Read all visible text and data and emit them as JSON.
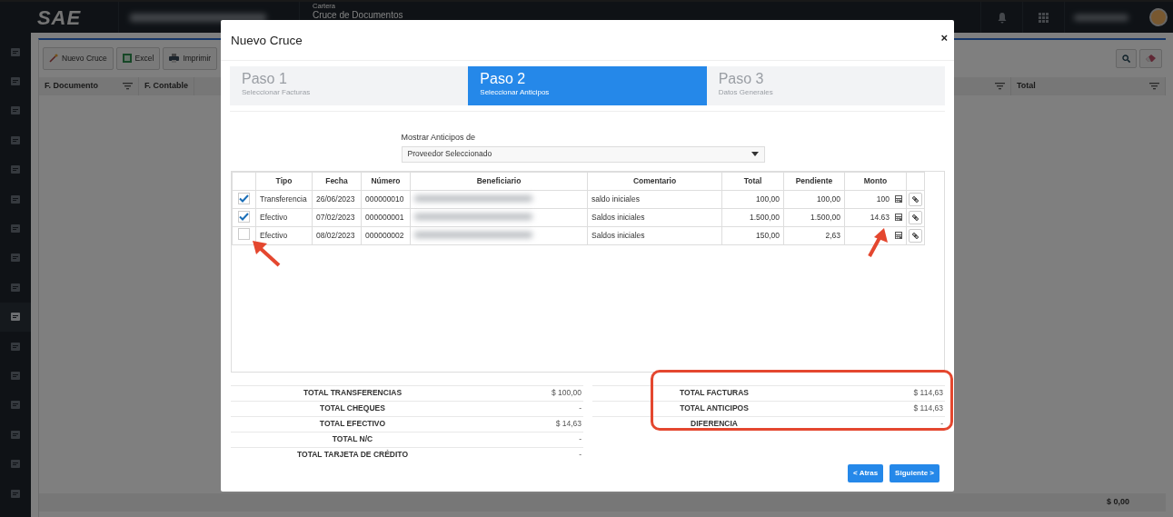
{
  "app": {
    "logo": "SAE",
    "section": "Cartera",
    "page_title": "Cruce de Documentos",
    "sidebar_items": [
      {
        "selected": false
      },
      {
        "selected": false
      },
      {
        "selected": false
      },
      {
        "selected": false
      },
      {
        "selected": false
      },
      {
        "selected": false
      },
      {
        "selected": false
      },
      {
        "selected": false
      },
      {
        "selected": false
      },
      {
        "selected": true
      },
      {
        "selected": false
      },
      {
        "selected": false
      },
      {
        "selected": false
      },
      {
        "selected": false
      },
      {
        "selected": false
      },
      {
        "selected": false
      }
    ],
    "toolbar": [
      "Nuevo Cruce",
      "Excel",
      "Imprimir"
    ],
    "grid_columns": [
      "F. Documento",
      "F. Contable",
      "Total"
    ],
    "grid_footer_total": "$ 0,00"
  },
  "modal": {
    "title": "Nuevo Cruce",
    "close": "×",
    "steps": [
      {
        "title": "Paso 1",
        "subtitle": "Seleccionar Facturas",
        "selected": false
      },
      {
        "title": "Paso 2",
        "subtitle": "Seleccionar Anticipos",
        "selected": true
      },
      {
        "title": "Paso 3",
        "subtitle": "Datos Generales",
        "selected": false
      }
    ],
    "filter": {
      "label": "Mostrar Anticipos de",
      "value": "Proveedor Seleccionado"
    },
    "table": {
      "columns": [
        "Tipo",
        "Fecha",
        "Número",
        "Beneficiario",
        "Comentario",
        "Total",
        "Pendiente",
        "Monto"
      ],
      "rows": [
        {
          "checked": true,
          "tipo": "Transferencia",
          "fecha": "26/06/2023",
          "numero": "000000010",
          "comentario": "saldo iniciales",
          "total": "100,00",
          "pendiente": "100,00",
          "monto": "100"
        },
        {
          "checked": true,
          "tipo": "Efectivo",
          "fecha": "07/02/2023",
          "numero": "000000001",
          "comentario": "Saldos iniciales",
          "total": "1.500,00",
          "pendiente": "1.500,00",
          "monto": "14.63"
        },
        {
          "checked": false,
          "tipo": "Efectivo",
          "fecha": "08/02/2023",
          "numero": "000000002",
          "comentario": "Saldos iniciales",
          "total": "150,00",
          "pendiente": "2,63"
        }
      ]
    },
    "totals_left": [
      {
        "label": "TOTAL TRANSFERENCIAS",
        "value": "$ 100,00"
      },
      {
        "label": "TOTAL CHEQUES",
        "value": "-"
      },
      {
        "label": "TOTAL EFECTIVO",
        "value": "$ 14,63"
      },
      {
        "label": "TOTAL N/C",
        "value": "-"
      },
      {
        "label": "TOTAL TARJETA DE CRÉDITO",
        "value": "-"
      }
    ],
    "totals_right": [
      {
        "label": "TOTAL FACTURAS",
        "value": "$ 114,63"
      },
      {
        "label": "TOTAL ANTICIPOS",
        "value": "$ 114,63"
      },
      {
        "label": "DIFERENCIA",
        "value": "-"
      }
    ],
    "buttons": [
      "< Atras",
      "Siguiente >"
    ]
  }
}
